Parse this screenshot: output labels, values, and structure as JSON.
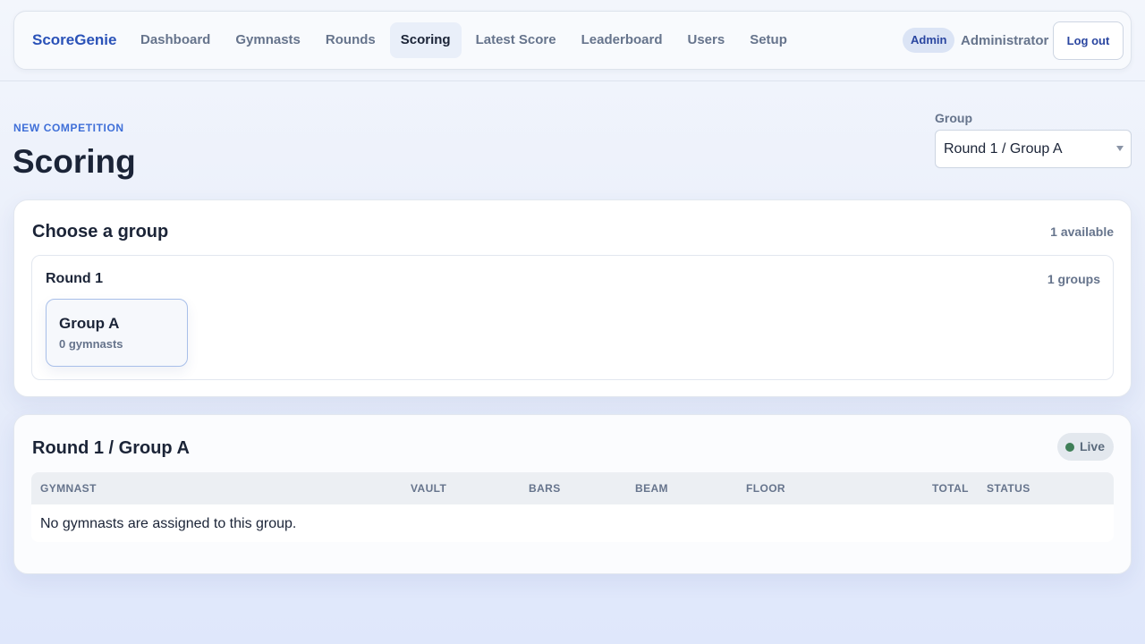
{
  "app": {
    "brand": "ScoreGenie"
  },
  "nav": {
    "items": [
      {
        "label": "Dashboard",
        "active": false
      },
      {
        "label": "Gymnasts",
        "active": false
      },
      {
        "label": "Rounds",
        "active": false
      },
      {
        "label": "Scoring",
        "active": true
      },
      {
        "label": "Latest Score",
        "active": false
      },
      {
        "label": "Leaderboard",
        "active": false
      },
      {
        "label": "Users",
        "active": false
      },
      {
        "label": "Setup",
        "active": false
      }
    ]
  },
  "user": {
    "role_badge": "Admin",
    "name": "Administrator",
    "logout_label": "Log out"
  },
  "header": {
    "eyebrow": "NEW COMPETITION",
    "title": "Scoring",
    "group_label": "Group",
    "group_selected": "Round 1 / Group A"
  },
  "chooser": {
    "title": "Choose a group",
    "available": "1 available",
    "rounds": [
      {
        "name": "Round 1",
        "count": "1 groups",
        "groups": [
          {
            "name": "Group A",
            "sub": "0 gymnasts"
          }
        ]
      }
    ]
  },
  "scoreboard": {
    "title": "Round 1 / Group A",
    "status_label": "Live",
    "columns": [
      "GYMNAST",
      "VAULT",
      "BARS",
      "BEAM",
      "FLOOR",
      "TOTAL",
      "STATUS"
    ],
    "empty_message": "No gymnasts are assigned to this group."
  },
  "colors": {
    "accent": "#2a52b8",
    "eyebrow": "#3f6fd8",
    "live_dot": "#3f7f58"
  }
}
